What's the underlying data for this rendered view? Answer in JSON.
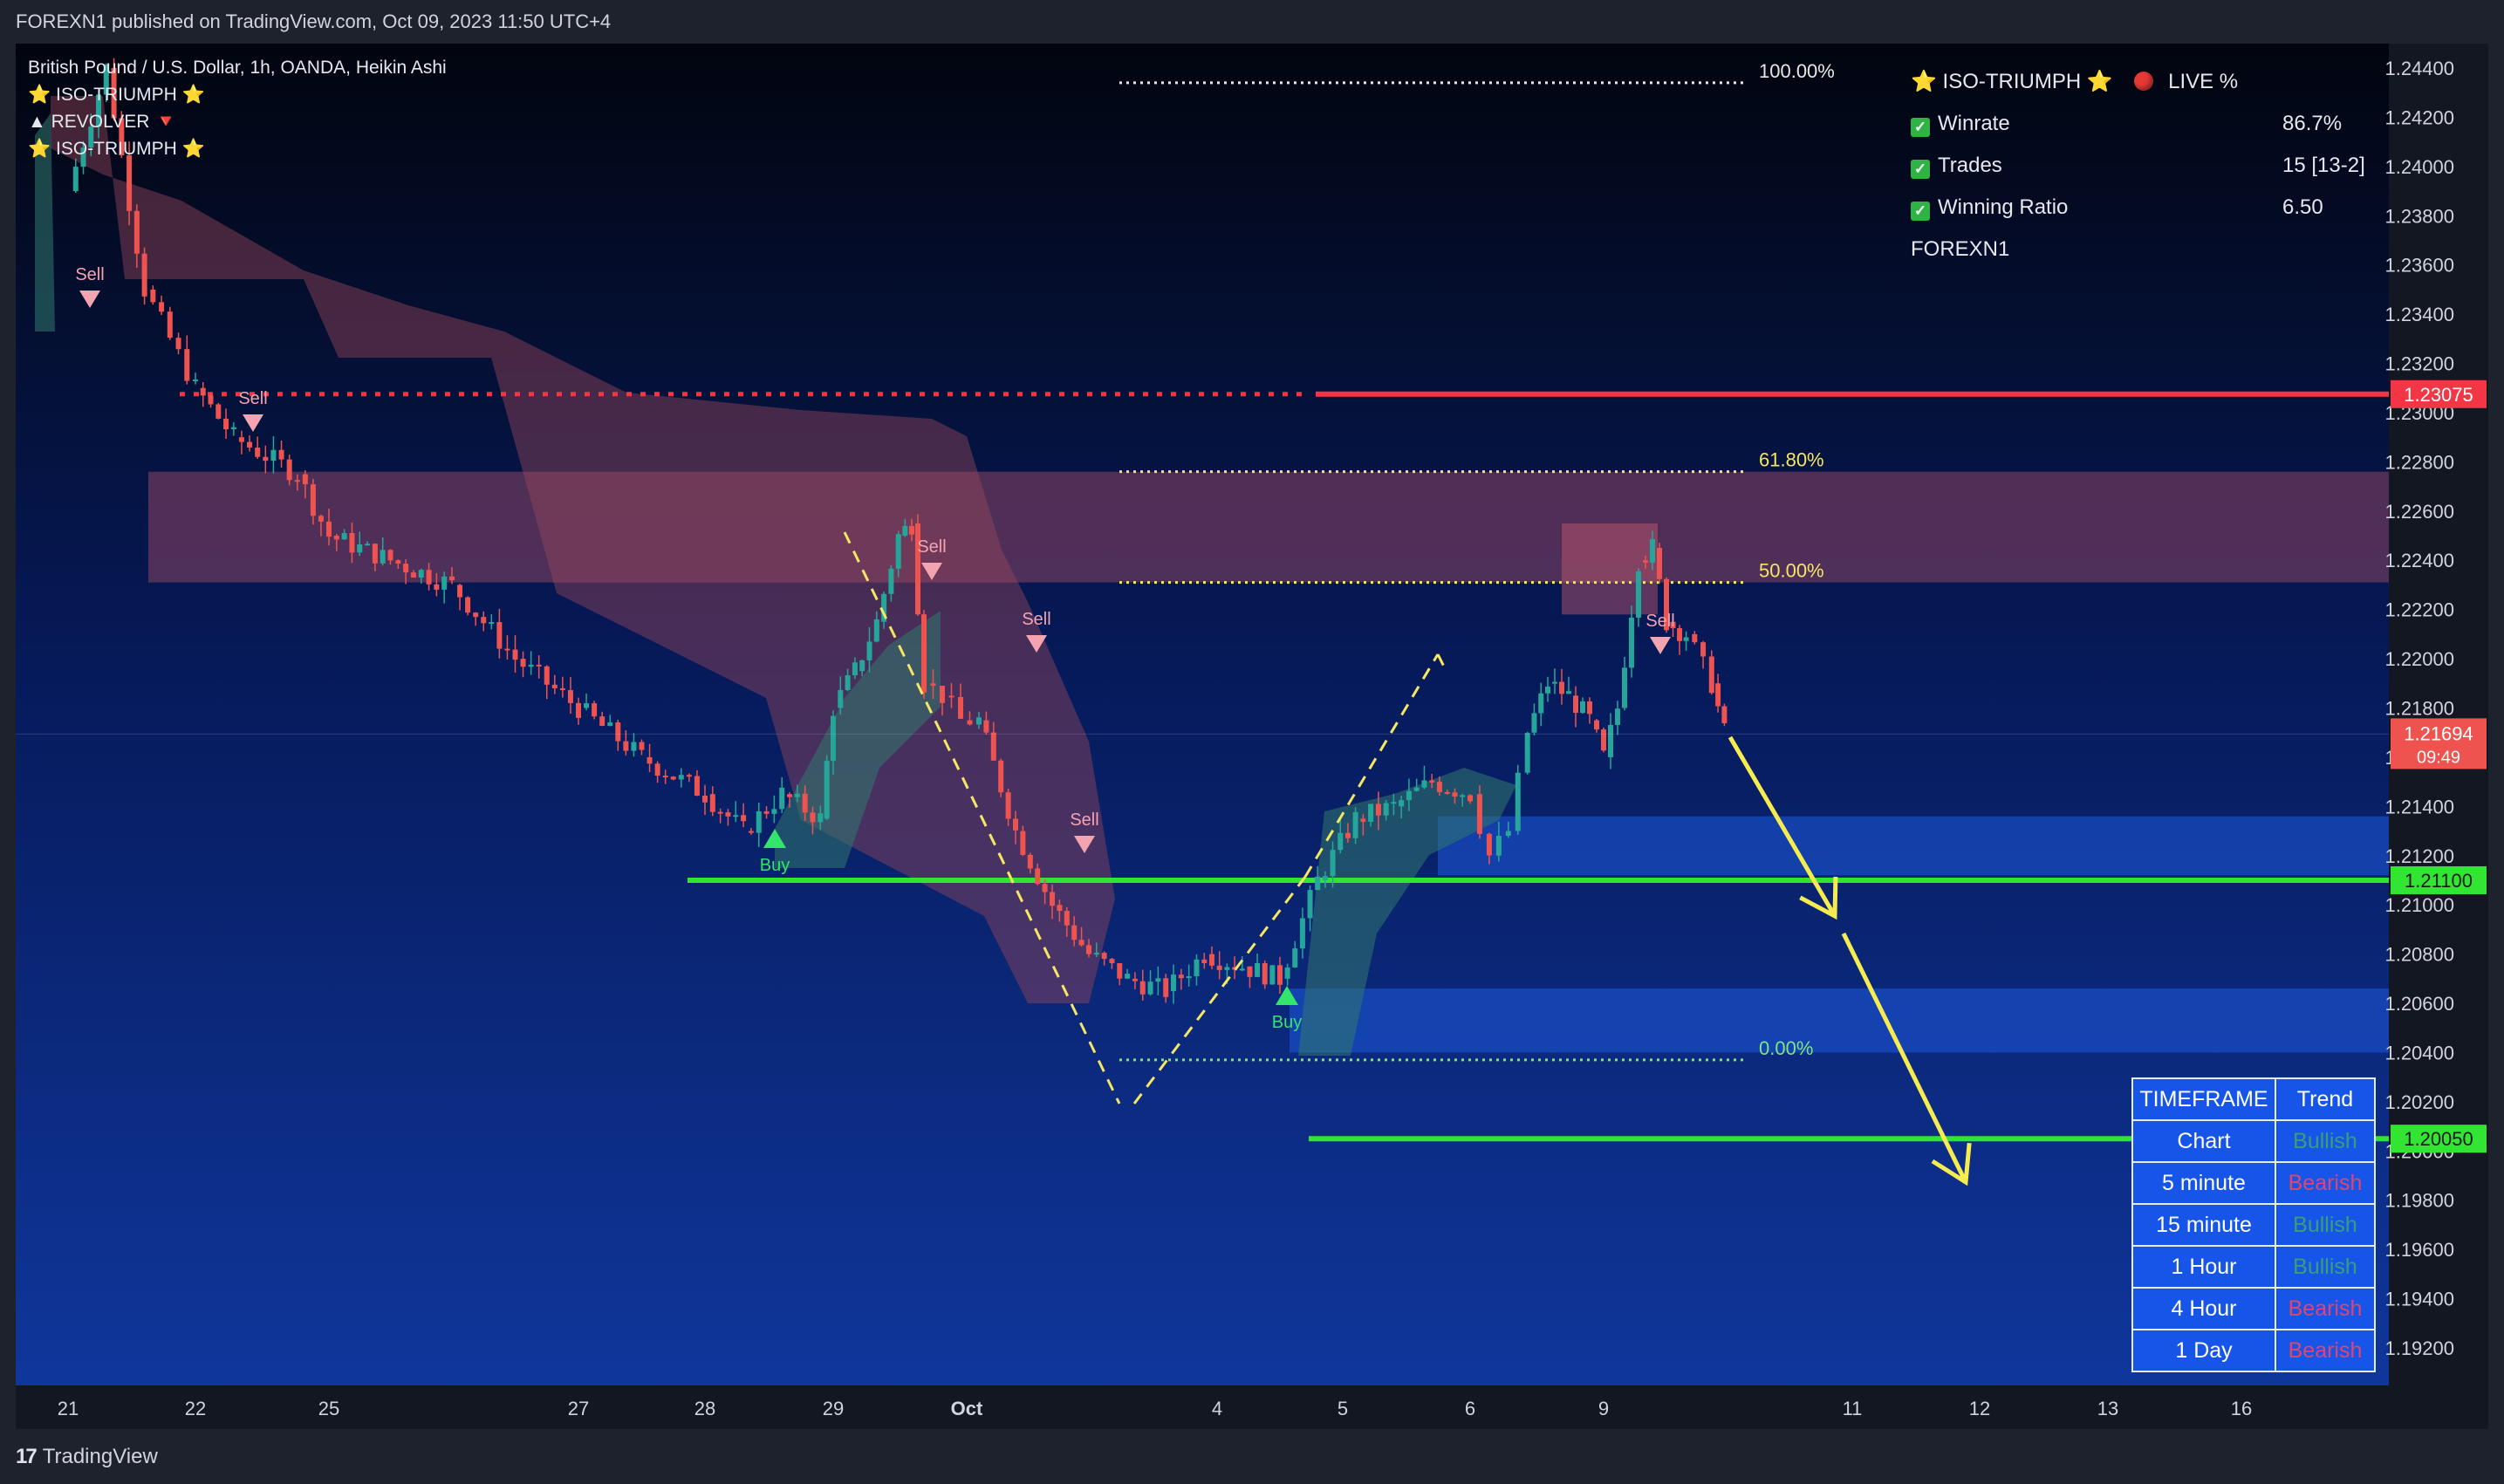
{
  "header": {
    "published": "FOREXN1 published on TradingView.com, Oct 09, 2023 11:50 UTC+4"
  },
  "footer": {
    "brand": "TradingView",
    "logo_mark": "17"
  },
  "legend": {
    "symbol": "British Pound / U.S. Dollar, 1h, OANDA, Heikin Ashi",
    "indicator1": "⭐ ISO-TRIUMPH ⭐",
    "indicator2": "▲ REVOLVER 🔻",
    "indicator3": "⭐ ISO-TRIUMPH ⭐"
  },
  "stats": {
    "title": "⭐ ISO-TRIUMPH ⭐",
    "live_label": "LIVE %",
    "rows": [
      {
        "label": "Winrate",
        "value": "86.7%"
      },
      {
        "label": "Trades",
        "value": "15 [13-2]"
      },
      {
        "label": "Winning Ratio",
        "value": "6.50"
      }
    ],
    "author": "FOREXN1"
  },
  "timeframe_table": {
    "header": [
      "TIMEFRAME",
      "Trend"
    ],
    "rows": [
      {
        "tf": "Chart",
        "trend": "Bullish",
        "dir": "bull"
      },
      {
        "tf": "5 minute",
        "trend": "Bearish",
        "dir": "bear"
      },
      {
        "tf": "15 minute",
        "trend": "Bullish",
        "dir": "bull"
      },
      {
        "tf": "1 Hour",
        "trend": "Bullish",
        "dir": "bull"
      },
      {
        "tf": "4 Hour",
        "trend": "Bearish",
        "dir": "bear"
      },
      {
        "tf": "1 Day",
        "trend": "Bearish",
        "dir": "bear"
      }
    ]
  },
  "colors": {
    "bg_top": "#02050f",
    "bg_bottom": "#1038a0",
    "bull_candle": "#26a69a",
    "bear_candle": "#ef5350",
    "red_level": "#f23645",
    "green_level": "#33e533",
    "fib_yellow": "#f5e663",
    "arrow_yellow": "#f7ec4f"
  },
  "chart_data": {
    "type": "candlestick",
    "title": "British Pound / U.S. Dollar, 1h, OANDA, Heikin Ashi",
    "x_ticks": [
      "21",
      "22",
      "25",
      "27",
      "28",
      "29",
      "Oct",
      "4",
      "5",
      "6",
      "9",
      "11",
      "12",
      "13",
      "16"
    ],
    "y_ticks": [
      "1.24400",
      "1.24200",
      "1.24000",
      "1.23800",
      "1.23600",
      "1.23400",
      "1.23200",
      "1.23000",
      "1.22800",
      "1.22600",
      "1.22400",
      "1.22200",
      "1.22000",
      "1.21800",
      "1.21600",
      "1.21400",
      "1.21200",
      "1.21000",
      "1.20800",
      "1.20600",
      "1.20400",
      "1.20200",
      "1.20000",
      "1.19800",
      "1.19600",
      "1.19400",
      "1.19200"
    ],
    "ylim": [
      1.1905,
      1.245
    ],
    "price_path": [
      [
        21,
        1.239
      ],
      [
        21.3,
        1.244
      ],
      [
        21.6,
        1.235
      ],
      [
        22,
        1.231
      ],
      [
        22.3,
        1.229
      ],
      [
        22.8,
        1.2275
      ],
      [
        25,
        1.225
      ],
      [
        25.5,
        1.224
      ],
      [
        26,
        1.223
      ],
      [
        26.5,
        1.22
      ],
      [
        27,
        1.218
      ],
      [
        27.5,
        1.216
      ],
      [
        28,
        1.2145
      ],
      [
        28.3,
        1.213
      ],
      [
        28.6,
        1.2145
      ],
      [
        28.9,
        1.2135
      ],
      [
        29,
        1.218
      ],
      [
        29.3,
        1.2195
      ],
      [
        29.6,
        1.2215
      ],
      [
        29.9,
        1.225
      ],
      [
        30.1,
        1.2255
      ],
      [
        30.3,
        1.219
      ],
      [
        30.6,
        1.2185
      ],
      [
        30.9,
        1.2175
      ],
      [
        31.1,
        1.2175
      ],
      [
        31.4,
        1.213
      ],
      [
        31.7,
        1.21
      ],
      [
        32,
        1.208
      ],
      [
        32.3,
        1.207
      ],
      [
        32.6,
        1.2065
      ],
      [
        32.9,
        1.208
      ],
      [
        33.2,
        1.2075
      ],
      [
        33.5,
        1.207
      ],
      [
        33.8,
        1.211
      ],
      [
        34.1,
        1.2135
      ],
      [
        34.4,
        1.214
      ],
      [
        34.7,
        1.215
      ],
      [
        35,
        1.2145
      ],
      [
        35.3,
        1.212
      ],
      [
        35.6,
        1.213
      ],
      [
        35.9,
        1.217
      ],
      [
        36.2,
        1.219
      ],
      [
        36.5,
        1.2185
      ],
      [
        36.8,
        1.2175
      ],
      [
        37.0,
        1.216
      ],
      [
        37.2,
        1.218
      ],
      [
        37.5,
        1.224
      ],
      [
        37.7,
        1.2245
      ],
      [
        37.9,
        1.2215
      ],
      [
        38.1,
        1.221
      ],
      [
        38.3,
        1.219
      ],
      [
        38.4,
        1.217
      ]
    ],
    "signals": [
      {
        "label": "Sell",
        "type": "sell"
      },
      {
        "label": "Sell",
        "type": "sell"
      },
      {
        "label": "Buy",
        "type": "buy"
      },
      {
        "label": "Sell",
        "type": "sell"
      },
      {
        "label": "Sell",
        "type": "sell"
      },
      {
        "label": "Sell",
        "type": "sell"
      },
      {
        "label": "Buy",
        "type": "buy"
      },
      {
        "label": "Sell",
        "type": "sell"
      }
    ],
    "levels": [
      {
        "price": 1.23075,
        "label": "1.23075",
        "color": "#f23645",
        "kind": "resistance"
      },
      {
        "price": 1.211,
        "label": "1.21100",
        "color": "#33e533",
        "kind": "support"
      },
      {
        "price": 1.2005,
        "label": "1.20050",
        "color": "#33e533",
        "kind": "target"
      }
    ],
    "current_price": {
      "label": "1.21694",
      "countdown": "09:49"
    },
    "fibonacci": [
      {
        "label": "100.00%",
        "price": 1.2434
      },
      {
        "label": "61.80%",
        "price": 1.2276
      },
      {
        "label": "50.00%",
        "price": 1.2231
      },
      {
        "label": "0.00%",
        "price": 1.2037
      }
    ],
    "zones": [
      {
        "kind": "supply",
        "from": 1.2231,
        "to": 1.2276
      },
      {
        "kind": "demand",
        "from": 1.2112,
        "to": 1.2136
      },
      {
        "kind": "demand",
        "from": 1.204,
        "to": 1.2066
      }
    ],
    "grid": false,
    "legend_position": "top-left"
  }
}
